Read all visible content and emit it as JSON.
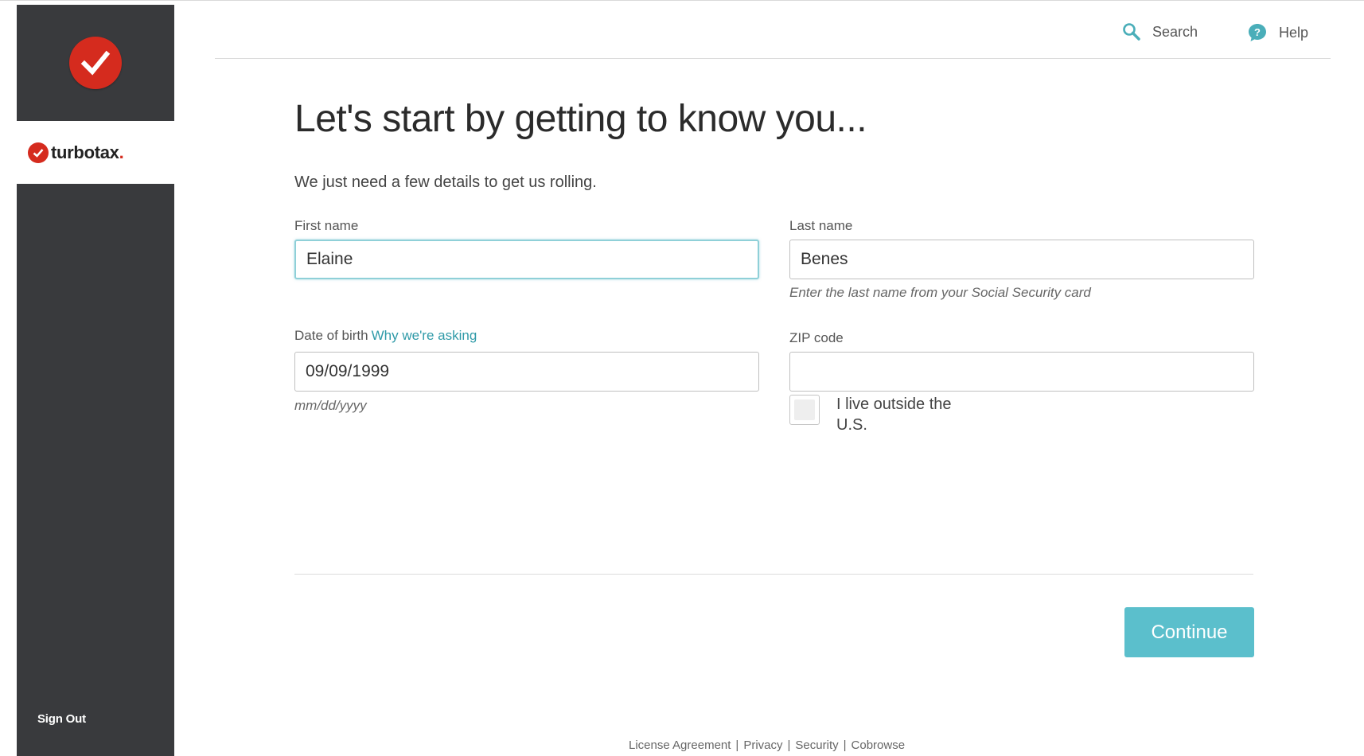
{
  "colors": {
    "sidebar_bg": "#393a3d",
    "brand_red": "#d52b1e",
    "accent_teal": "#5bbfcc",
    "link_teal": "#2f9aa8"
  },
  "sidebar": {
    "logo_icon": "checkmark-circle-icon",
    "brand_name": "turbotax",
    "brand_suffix": ".",
    "sign_out_label": "Sign Out"
  },
  "header": {
    "search_icon": "search-icon",
    "search_label": "Search",
    "help_icon": "help-icon",
    "help_label": "Help"
  },
  "main": {
    "title": "Let's start by getting to know you...",
    "subtitle": "We just need a few details to get us rolling.",
    "first_name": {
      "label": "First name",
      "value": "Elaine"
    },
    "last_name": {
      "label": "Last name",
      "value": "Benes",
      "hint": "Enter the last name from your Social Security card"
    },
    "dob": {
      "label": "Date of birth",
      "link": "Why we're asking",
      "value": "09/09/1999",
      "hint": "mm/dd/yyyy"
    },
    "zip": {
      "label": "ZIP code",
      "value": ""
    },
    "outside_us": {
      "label_line1": "I live outside the",
      "label_line2": "U.S.",
      "checked": false
    },
    "continue_label": "Continue"
  },
  "footer": {
    "links": [
      "License Agreement",
      "Privacy",
      "Security",
      "Cobrowse"
    ],
    "separator": "|"
  }
}
